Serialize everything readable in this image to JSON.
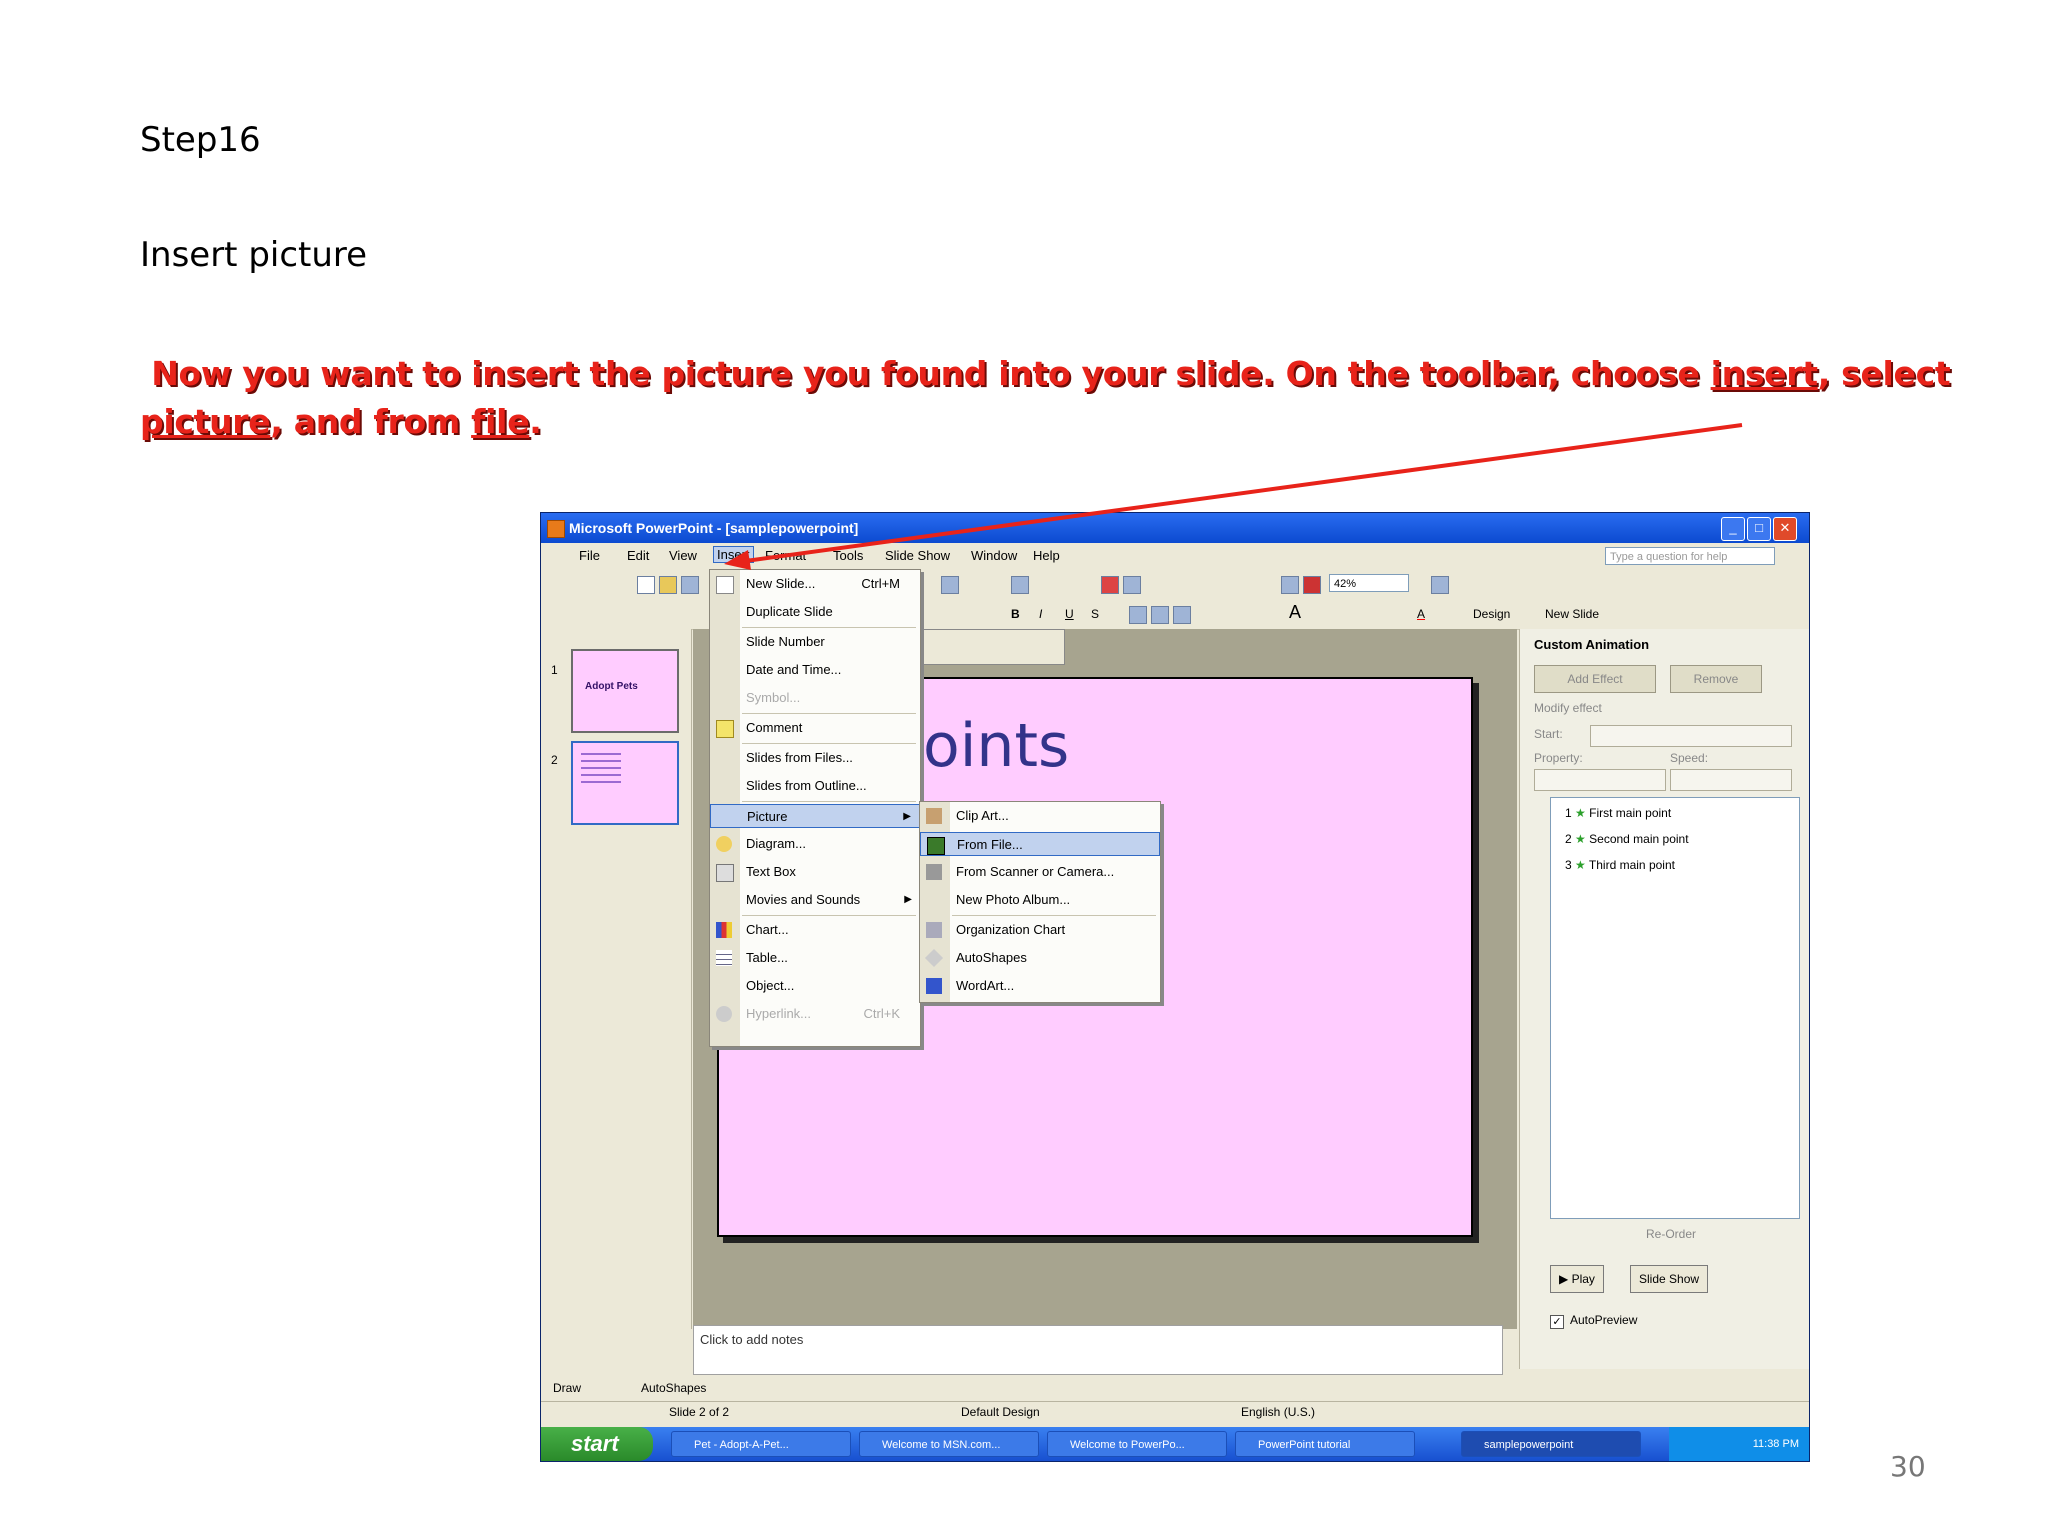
{
  "step": "Step16",
  "subtitle": "Insert picture",
  "instruction": {
    "part1": "Now you want to insert the picture you found into your slide. On the toolbar, choose ",
    "insert": "insert",
    "part2": ", select ",
    "picture": "picture",
    "part3": ", and from ",
    "file": "file",
    "part4": "."
  },
  "page_number": "30",
  "colors": {
    "instruction": "#e8231a",
    "arrow": "#e8231a",
    "slide_bg": "#ffccff",
    "titlebar": "#0c4ad0"
  },
  "window": {
    "title": "Microsoft PowerPoint - [samplepowerpoint]",
    "help_placeholder": "Type a question for help",
    "menus": [
      "File",
      "Edit",
      "View",
      "Insert",
      "Format",
      "Tools",
      "Slide Show",
      "Window",
      "Help"
    ],
    "zoom": "42%",
    "design_label": "Design",
    "new_slide_label": "New Slide"
  },
  "slides": [
    {
      "num": "1",
      "title": "Adopt Pets"
    },
    {
      "num": "2",
      "title": ""
    }
  ],
  "slide_title_visible": "Points",
  "notes_placeholder": "Click to add notes",
  "insert_menu": [
    {
      "label": "New Slide...",
      "shortcut": "Ctrl+M",
      "icon": "new-slide-icon"
    },
    {
      "label": "Duplicate Slide",
      "icon": ""
    },
    {
      "label": "Slide Number",
      "icon": ""
    },
    {
      "label": "Date and Time...",
      "icon": ""
    },
    {
      "label": "Symbol...",
      "disabled": true,
      "icon": ""
    },
    {
      "label": "Comment",
      "icon": "comment-icon"
    },
    {
      "label": "Slides from Files...",
      "icon": ""
    },
    {
      "label": "Slides from Outline...",
      "icon": ""
    },
    {
      "label": "Picture",
      "submenu": true,
      "highlighted": true,
      "icon": ""
    },
    {
      "label": "Diagram...",
      "icon": "diagram-icon"
    },
    {
      "label": "Text Box",
      "icon": "text-box-icon"
    },
    {
      "label": "Movies and Sounds",
      "submenu": true,
      "icon": ""
    },
    {
      "label": "Chart...",
      "icon": "chart-icon"
    },
    {
      "label": "Table...",
      "icon": "table-icon"
    },
    {
      "label": "Object...",
      "icon": ""
    },
    {
      "label": "Hyperlink...",
      "shortcut": "Ctrl+K",
      "disabled": true,
      "icon": "hyperlink-icon"
    }
  ],
  "picture_submenu": [
    {
      "label": "Clip Art...",
      "icon": "clip-art-icon"
    },
    {
      "label": "From File...",
      "highlighted": true,
      "icon": "from-file-icon"
    },
    {
      "label": "From Scanner or Camera...",
      "icon": "scanner-icon"
    },
    {
      "label": "New Photo Album...",
      "icon": ""
    },
    {
      "label": "Organization Chart",
      "icon": "org-chart-icon"
    },
    {
      "label": "AutoShapes",
      "icon": "autoshapes-icon"
    },
    {
      "label": "WordArt...",
      "icon": "wordart-icon"
    }
  ],
  "task_pane": {
    "title": "Custom Animation",
    "add_effect": "Add Effect",
    "remove": "Remove",
    "modify_effect": "Modify effect",
    "start": "Start:",
    "property": "Property:",
    "speed": "Speed:",
    "animations": [
      {
        "num": "1",
        "label": "First main point"
      },
      {
        "num": "2",
        "label": "Second main point"
      },
      {
        "num": "3",
        "label": "Third main point"
      }
    ],
    "reorder": "Re-Order",
    "play": "Play",
    "slide_show": "Slide Show",
    "autopreview": "AutoPreview"
  },
  "draw_toolbar": {
    "draw": "Draw",
    "autoshapes": "AutoShapes"
  },
  "status_bar": {
    "slide": "Slide 2 of 2",
    "design": "Default Design",
    "language": "English (U.S.)"
  },
  "taskbar": {
    "start": "start",
    "tasks": [
      "Pet - Adopt-A-Pet...",
      "Welcome to MSN.com...",
      "Welcome to PowerPo...",
      "PowerPoint tutorial",
      "samplepowerpoint"
    ],
    "clock": "11:38 PM"
  }
}
